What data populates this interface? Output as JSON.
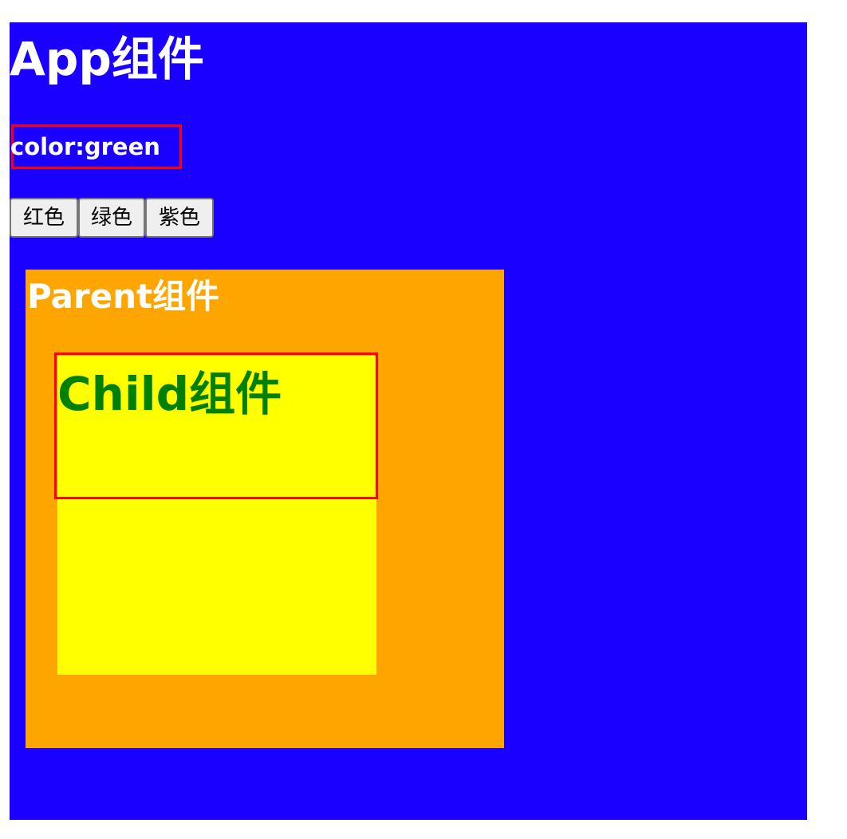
{
  "app": {
    "title": "App组件",
    "color_readout": "color:green",
    "background_color": "#1a00ff"
  },
  "buttons": [
    {
      "label": "红色"
    },
    {
      "label": "绿色"
    },
    {
      "label": "紫色"
    }
  ],
  "parent": {
    "title": "Parent组件",
    "background_color": "#ffa500"
  },
  "child": {
    "title": "Child组件",
    "background_color": "#ffff00",
    "text_color": "#008000"
  },
  "colors": {
    "highlight_border": "#ff0000"
  }
}
